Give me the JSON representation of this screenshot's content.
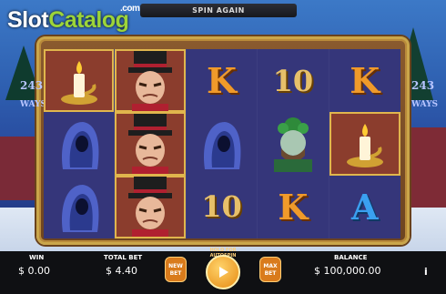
{
  "logo": {
    "part1": "Slot",
    "part2": "Catalog",
    "suffix": ".com"
  },
  "banner": {
    "text": "SPIN AGAIN"
  },
  "side": {
    "ways_number": "243",
    "ways_label": "WAYS"
  },
  "reels": [
    [
      "candle",
      "scrooge",
      "K",
      "10",
      "K"
    ],
    [
      "cloak",
      "scrooge",
      "cloak",
      "ghost",
      "candle"
    ],
    [
      "cloak",
      "scrooge",
      "10",
      "K",
      "A"
    ]
  ],
  "highlights": [
    [
      true,
      true,
      false,
      false,
      false
    ],
    [
      false,
      true,
      false,
      false,
      true
    ],
    [
      false,
      true,
      false,
      false,
      false
    ]
  ],
  "bottom_bar": {
    "win_label": "WIN",
    "win_value": "$ 0.00",
    "total_bet_label": "TOTAL BET",
    "total_bet_value": "$ 4.40",
    "new_bet_label": "NEW BET",
    "autospin_label": "HOLD FOR AUTOSPIN",
    "max_bet_label": "MAX BET",
    "balance_label": "BALANCE",
    "balance_value": "$ 100,000.00",
    "info_label": "i"
  },
  "colors": {
    "accent": "#d97b1c",
    "logo_green": "#9cd43a",
    "reel_bg": "#2e2f70"
  },
  "icons": {
    "spin": "play-triangle-icon",
    "info": "info-icon"
  }
}
